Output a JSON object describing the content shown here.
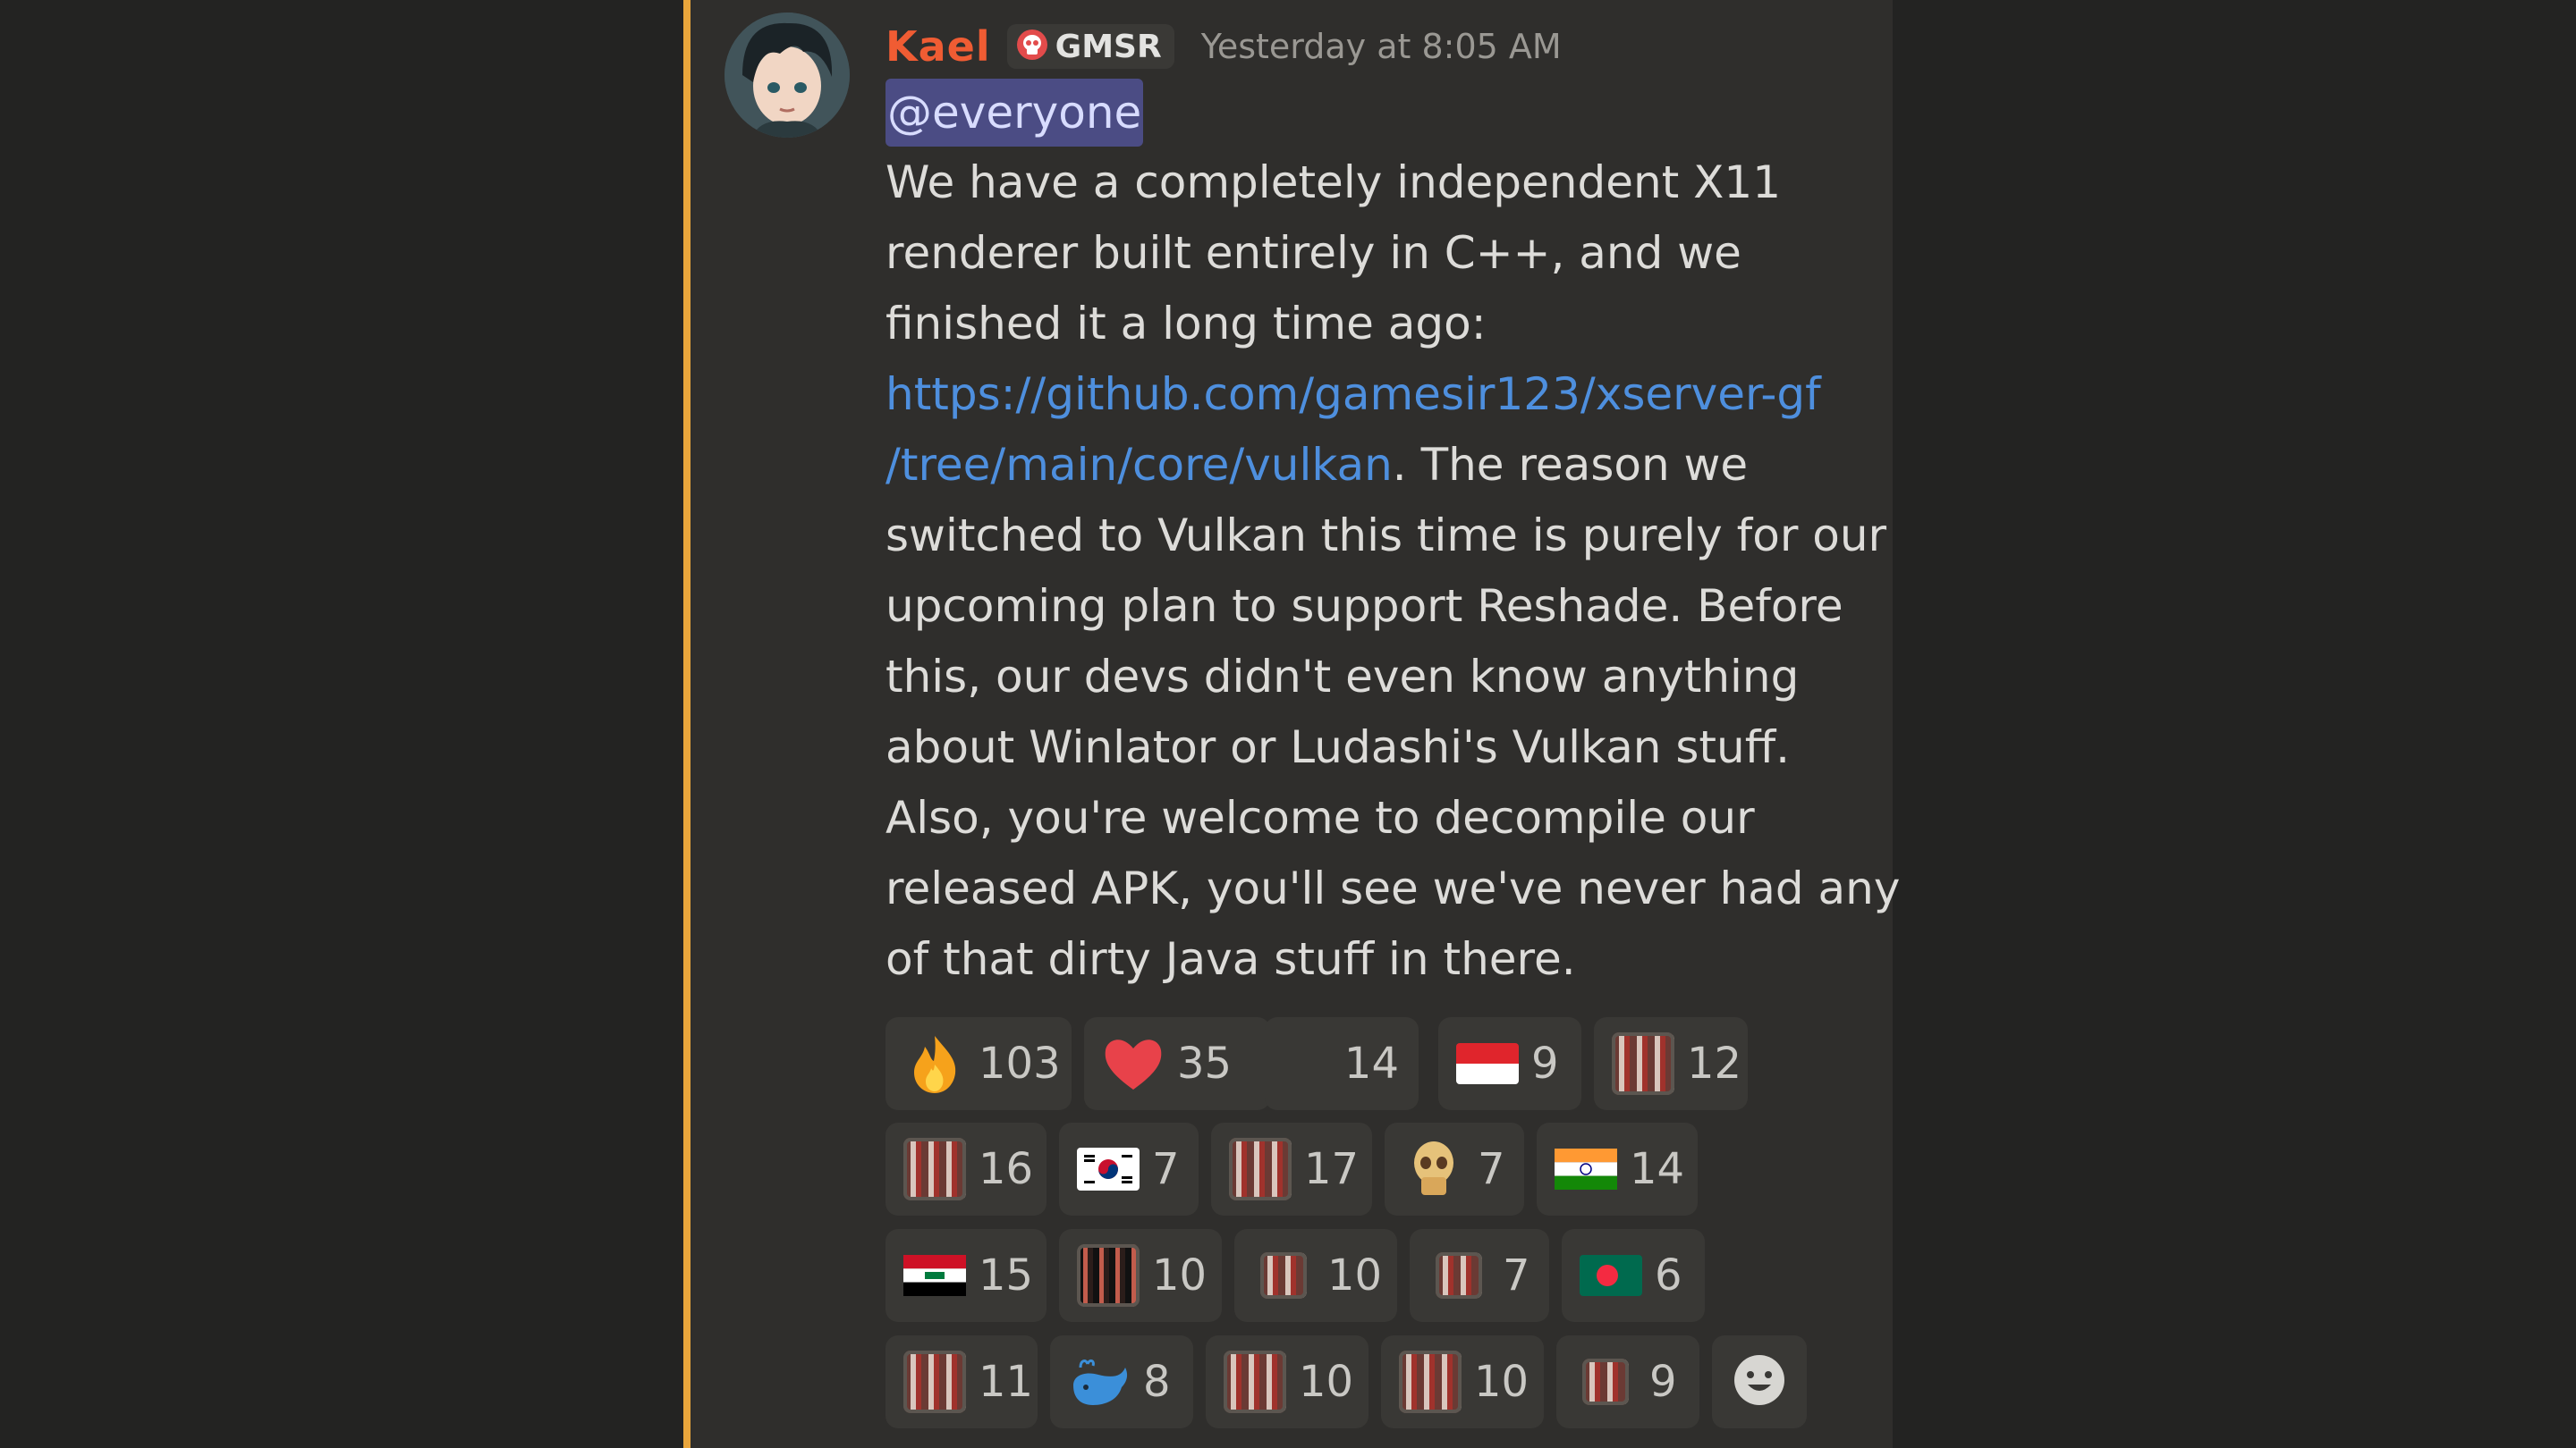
{
  "message": {
    "author": "Kael",
    "server_tag": "GMSR",
    "timestamp": "Yesterday at 8:05 AM",
    "mention": "@everyone",
    "lines": [
      "We have a completely independent X11",
      "renderer built entirely in C++, and we",
      "finished it a long time ago:"
    ],
    "link_line1": "https://github.com/gamesir123/xserver-gf",
    "link_line2": "/tree/main/core/vulkan",
    "link_after": ". The reason we",
    "lines_after": [
      "switched to Vulkan this time is purely for our",
      "upcoming plan to support Reshade. Before",
      "this, our devs didn't even know anything",
      "about  Winlator or Ludashi's Vulkan stuff.",
      "Also, you're welcome to decompile our",
      "released APK, you'll see we've never had any",
      "of that dirty Java stuff in there."
    ]
  },
  "reactions": [
    [
      {
        "emoji": "fire-icon",
        "count": "103"
      },
      {
        "emoji": "heart-icon",
        "count": "35"
      },
      {
        "emoji": "blank-emoji",
        "count": "14"
      },
      {
        "emoji": "flag-indonesia-icon",
        "count": "9"
      },
      {
        "emoji": "custom-face-emoji",
        "count": "12"
      }
    ],
    [
      {
        "emoji": "custom-face-emoji",
        "count": "16"
      },
      {
        "emoji": "flag-south-korea-icon",
        "count": "7"
      },
      {
        "emoji": "custom-face-emoji",
        "count": "17"
      },
      {
        "emoji": "custom-skull-emoji",
        "count": "7"
      },
      {
        "emoji": "flag-india-icon",
        "count": "14"
      }
    ],
    [
      {
        "emoji": "flag-iraq-icon",
        "count": "15"
      },
      {
        "emoji": "custom-dark-faces-emoji",
        "count": "10"
      },
      {
        "emoji": "custom-small-face-emoji",
        "count": "10"
      },
      {
        "emoji": "custom-small-face-emoji",
        "count": "7"
      },
      {
        "emoji": "flag-bangladesh-icon",
        "count": "6"
      }
    ],
    [
      {
        "emoji": "custom-face-emoji",
        "count": "11"
      },
      {
        "emoji": "whale-icon",
        "count": "8"
      },
      {
        "emoji": "custom-face-emoji",
        "count": "10"
      },
      {
        "emoji": "custom-face-emoji",
        "count": "10"
      },
      {
        "emoji": "custom-small-face-emoji",
        "count": "9"
      }
    ]
  ],
  "colors": {
    "accent_bar": "#e9a53b",
    "author": "#f05c33",
    "link": "#4e8fde",
    "mention_bg": "#4b4c84"
  }
}
